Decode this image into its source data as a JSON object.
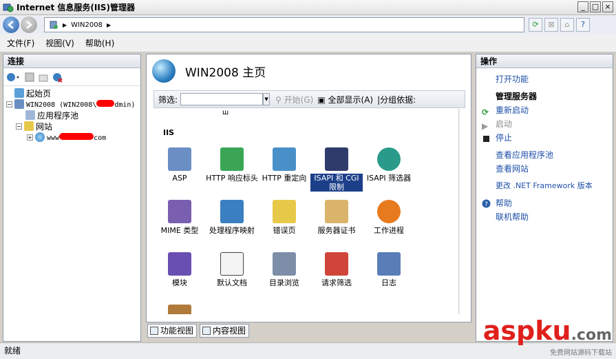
{
  "window": {
    "title": "Internet 信息服务(IIS)管理器",
    "controls": [
      "_",
      "□",
      "×"
    ]
  },
  "address": {
    "path": "WIN2008"
  },
  "menu": {
    "items": [
      {
        "label": "文件(F)"
      },
      {
        "label": "视图(V)"
      },
      {
        "label": "帮助(H)"
      }
    ]
  },
  "connections": {
    "title": "连接",
    "tree": [
      {
        "label": "起始页"
      },
      {
        "label_prefix": "WIN2008 (WIN2008\\",
        "label_suffix": "dmin)"
      },
      {
        "label": "应用程序池"
      },
      {
        "label": "网站"
      },
      {
        "label_prefix": "www",
        "label_suffix": "com"
      }
    ]
  },
  "center": {
    "title": "WIN2008 主页",
    "filter_label": "筛选:",
    "start_label": "开始(G)",
    "show_all_label": "全部显示(A)",
    "group_by_label": "|分组依据:",
    "section": "IIS",
    "features": [
      {
        "label": "ASP",
        "icon": "asp-icon",
        "color": "#6b8fc4"
      },
      {
        "label": "HTTP 响应标头",
        "icon": "http-headers-icon",
        "color": "#3aa655"
      },
      {
        "label": "HTTP 重定向",
        "icon": "http-redirect-icon",
        "color": "#4a90c8"
      },
      {
        "label": "ISAPI 和 CGI 限制",
        "icon": "isapi-cgi-icon",
        "color": "#2e3b6b"
      },
      {
        "label": "ISAPI 筛选器",
        "icon": "isapi-filter-icon",
        "color": "#2a9b8a"
      },
      {
        "label": "MIME 类型",
        "icon": "mime-types-icon",
        "color": "#7a5fb0"
      },
      {
        "label": "处理程序映射",
        "icon": "handler-mapping-icon",
        "color": "#3a7fc2"
      },
      {
        "label": "错误页",
        "icon": "error-page-icon",
        "color": "#e7c94a"
      },
      {
        "label": "服务器证书",
        "icon": "server-cert-icon",
        "color": "#d9b46a"
      },
      {
        "label": "工作进程",
        "icon": "worker-process-icon",
        "color": "#e87a1e"
      },
      {
        "label": "模块",
        "icon": "modules-icon",
        "color": "#6a4fb3"
      },
      {
        "label": "默认文档",
        "icon": "default-document-icon",
        "color": "#444444"
      },
      {
        "label": "目录浏览",
        "icon": "directory-browsing-icon",
        "color": "#7d8fa8"
      },
      {
        "label": "请求筛选",
        "icon": "request-filtering-icon",
        "color": "#d0453a"
      },
      {
        "label": "日志",
        "icon": "logging-icon",
        "color": "#5a7db8"
      }
    ],
    "views": [
      {
        "label": "功能视图"
      },
      {
        "label": "内容视图"
      }
    ]
  },
  "actions": {
    "title": "操作",
    "open_feature": "打开功能",
    "manage_server": "管理服务器",
    "restart": "重新启动",
    "start": "启动",
    "stop": "停止",
    "view_app_pools": "查看应用程序池",
    "view_sites": "查看网站",
    "change_framework": "更改 .NET Framework 版本",
    "help": "帮助",
    "online_help": "联机帮助"
  },
  "status": {
    "text": "就绪"
  },
  "watermark": {
    "brand_asp": "asp",
    "brand_ku": "ku",
    "brand_tld": ".com",
    "tagline": "免费网站源码下载站"
  }
}
